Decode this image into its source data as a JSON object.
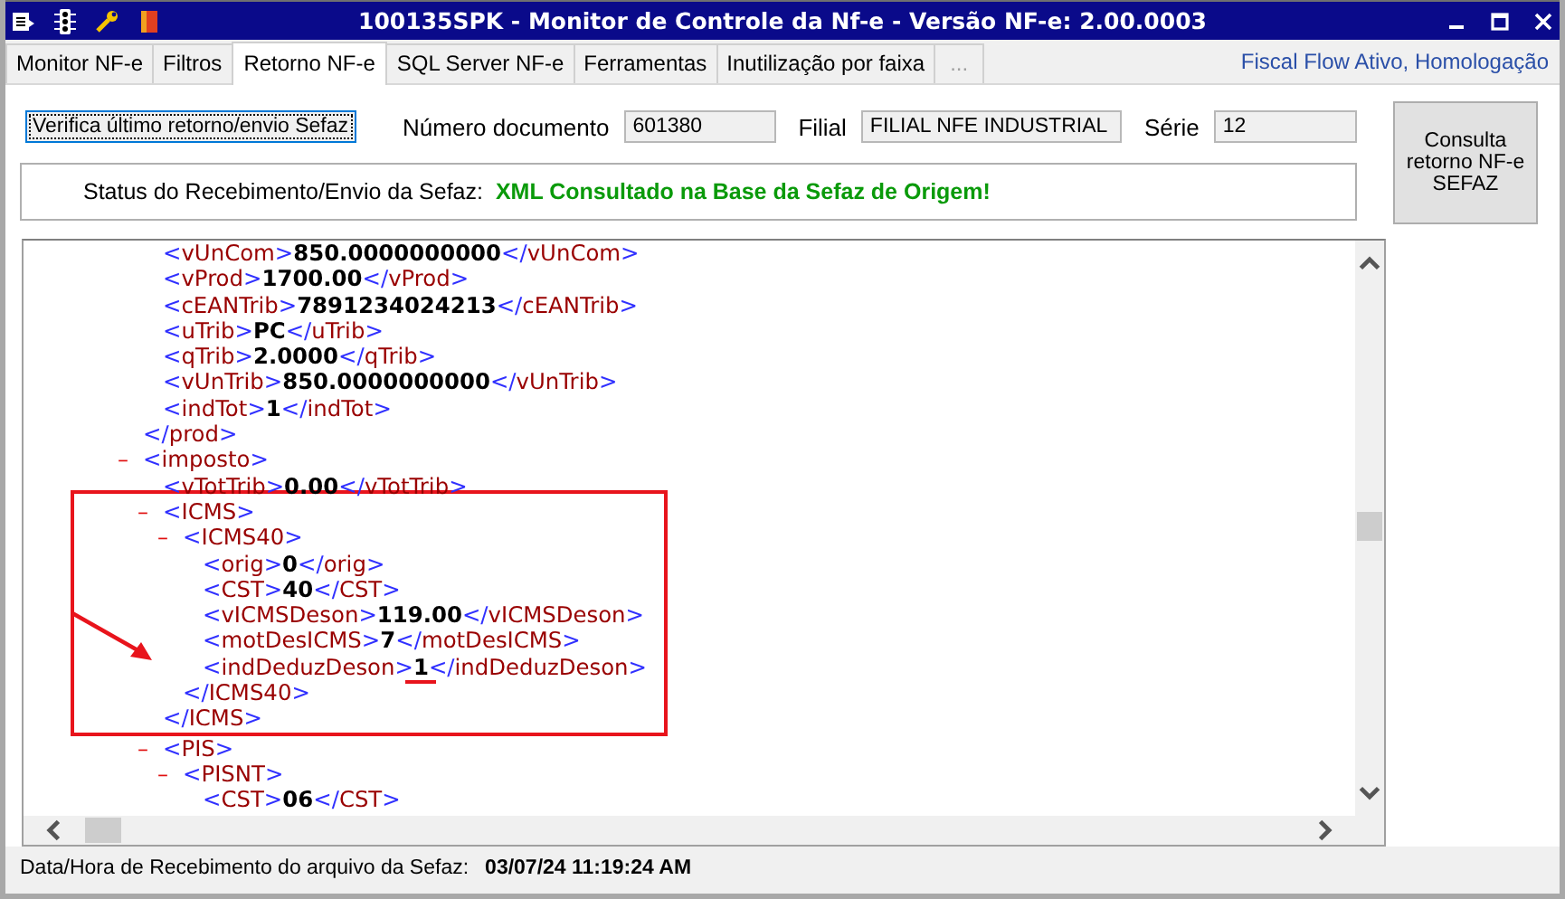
{
  "window": {
    "title": "100135SPK - Monitor de Controle da Nf-e - Versão NF-e: 2.00.0003"
  },
  "tabs": [
    {
      "label": "Monitor NF-e",
      "selected": false,
      "disabled": false
    },
    {
      "label": "Filtros",
      "selected": false,
      "disabled": false
    },
    {
      "label": "Retorno NF-e",
      "selected": true,
      "disabled": false
    },
    {
      "label": "SQL Server NF-e",
      "selected": false,
      "disabled": false
    },
    {
      "label": "Ferramentas",
      "selected": false,
      "disabled": false
    },
    {
      "label": "Inutilização por faixa",
      "selected": false,
      "disabled": false
    },
    {
      "label": "...",
      "selected": false,
      "disabled": true
    }
  ],
  "environment_label": "Fiscal Flow Ativo, Homologação",
  "check_button": {
    "label": "Verifica último retorno/envio Sefaz"
  },
  "fields": [
    {
      "label": "Número documento",
      "value": "601380"
    },
    {
      "label": "Filial",
      "value": "FILIAL NFE INDUSTRIAL"
    },
    {
      "label": "Série",
      "value": "12"
    }
  ],
  "status": {
    "label": "Status do Recebimento/Envio da Sefaz:",
    "message": "XML Consultado na Base da Sefaz de Origem!"
  },
  "query_button": {
    "label": "Consulta retorno NF-e SEFAZ"
  },
  "xml": [
    {
      "close": "</prod>",
      "children": [
        {
          "text": "<vUnCom>**850.0000000000**</vUnCom>"
        },
        {
          "text": "<vProd>**1700.00**</vProd>"
        },
        {
          "text": "<cEANTrib>**7891234024213**</cEANTrib>"
        },
        {
          "text": "<uTrib>**PC**</uTrib>"
        },
        {
          "text": "<qTrib>**2.0000**</qTrib>"
        },
        {
          "text": "<vUnTrib>**850.0000000000**</vUnTrib>"
        },
        {
          "text": "<indTot>**1**</indTot>"
        }
      ]
    },
    {
      "open": "<imposto>",
      "toggle": "–",
      "children": [
        {
          "text": "<vTotTrib>**0.00**</vTotTrib>"
        },
        {
          "open": "<ICMS>",
          "toggle": "–",
          "close": "</ICMS>",
          "highlighted": true,
          "children": [
            {
              "open": "<ICMS40>",
              "toggle": "–",
              "close": "</ICMS40>",
              "children": [
                {
                  "text": "<orig>**0**</orig>"
                },
                {
                  "text": "<CST>**40**</CST>"
                },
                {
                  "text": "<vICMSDeson>**119.00**</vICMSDeson>"
                },
                {
                  "text": "<motDesICMS>**7**</motDesICMS>"
                },
                {
                  "text": "<indDeduzDeson>**1**</indDeduzDeson>",
                  "arrow": true,
                  "underlined": true
                }
              ]
            }
          ]
        },
        {
          "open": "<PIS>",
          "toggle": "–",
          "children": [
            {
              "open": "<PISNT>",
              "toggle": "–",
              "children": [
                {
                  "text": "<CST>**06**</CST>"
                }
              ]
            }
          ]
        }
      ]
    }
  ],
  "footer": {
    "label": "Data/Hora de Recebimento do arquivo da Sefaz:",
    "value": "03/07/24 11:19:24 AM"
  }
}
